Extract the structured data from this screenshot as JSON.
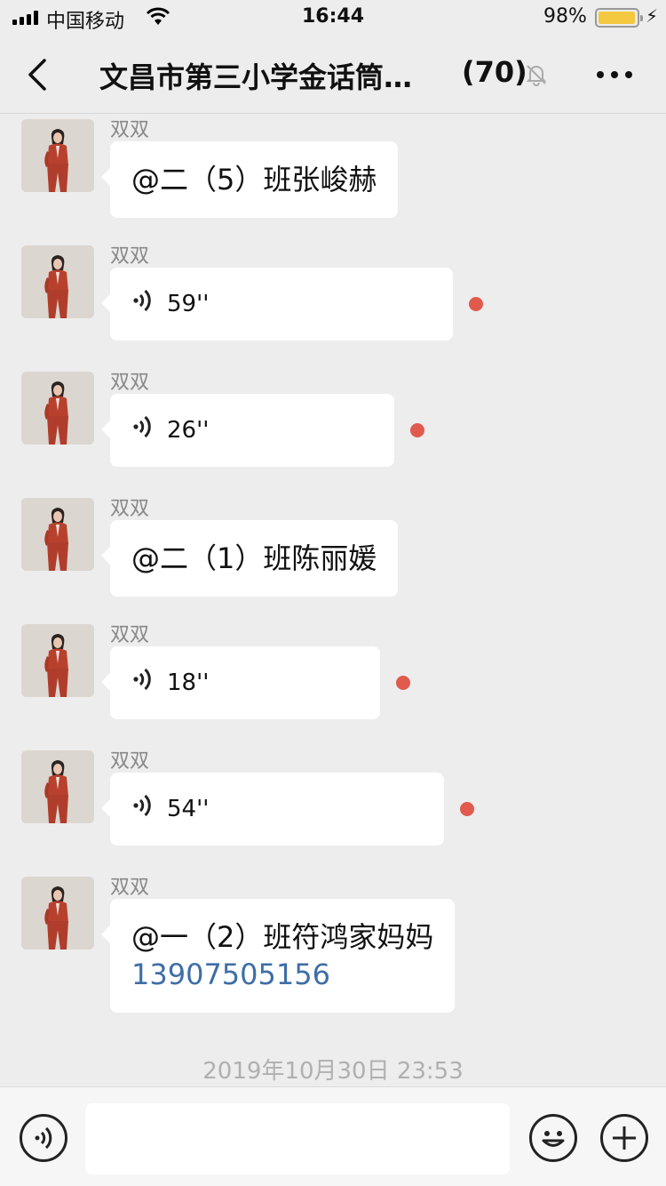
{
  "status_bar": {
    "carrier": "中国移动",
    "time": "16:44",
    "battery_percent": "98%",
    "battery_level": 0.98,
    "battery_color": "#f5c842"
  },
  "header": {
    "title": "文昌市第三小学金话筒…",
    "member_count": "(70)",
    "back_icon": "chevron-left-icon",
    "mute_icon": "bell-slash-icon",
    "more_icon": "ellipsis-icon"
  },
  "messages": [
    {
      "sender": "双双",
      "type": "text",
      "text": "@二（5）班张峻赫"
    },
    {
      "sender": "双双",
      "type": "voice",
      "duration": "59''",
      "unread": true
    },
    {
      "sender": "双双",
      "type": "voice",
      "duration": "26''",
      "unread": true
    },
    {
      "sender": "双双",
      "type": "text",
      "text": "@二（1）班陈丽媛"
    },
    {
      "sender": "双双",
      "type": "voice",
      "duration": "18''",
      "unread": true
    },
    {
      "sender": "双双",
      "type": "voice",
      "duration": "54''",
      "unread": true
    },
    {
      "sender": "双双",
      "type": "text",
      "text": "@一（2）班符鸿家妈妈",
      "link": "13907505156"
    }
  ],
  "timestamp": "2019年10月30日 23:53",
  "input_bar": {
    "voice_icon": "voice-icon",
    "emoji_icon": "emoji-icon",
    "plus_icon": "plus-icon",
    "placeholder": ""
  },
  "colors": {
    "unread_dot": "#e05a4e",
    "link": "#3e6ea6",
    "background": "#ededed"
  }
}
